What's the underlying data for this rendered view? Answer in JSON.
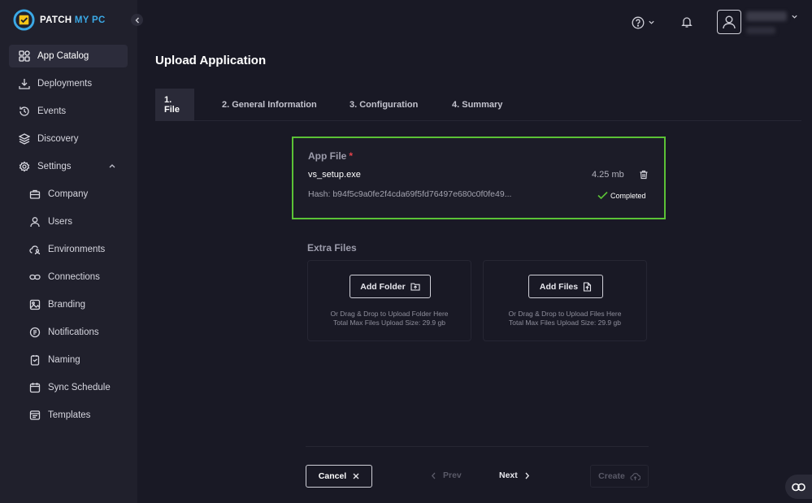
{
  "brand": {
    "name_part1": "PATCH ",
    "name_part2": "MY PC",
    "accent": "#3ba9e6"
  },
  "sidebar": {
    "items": [
      {
        "label": "App Catalog",
        "icon": "grid-icon"
      },
      {
        "label": "Deployments",
        "icon": "download-icon"
      },
      {
        "label": "Events",
        "icon": "history-icon"
      },
      {
        "label": "Discovery",
        "icon": "layers-icon"
      },
      {
        "label": "Settings",
        "icon": "gear-icon"
      },
      {
        "label": "Company",
        "icon": "briefcase-icon"
      },
      {
        "label": "Users",
        "icon": "user-icon"
      },
      {
        "label": "Environments",
        "icon": "cloud-user-icon"
      },
      {
        "label": "Connections",
        "icon": "link-icon"
      },
      {
        "label": "Branding",
        "icon": "image-icon"
      },
      {
        "label": "Notifications",
        "icon": "bell-list-icon"
      },
      {
        "label": "Naming",
        "icon": "naming-icon"
      },
      {
        "label": "Sync Schedule",
        "icon": "calendar-icon"
      },
      {
        "label": "Templates",
        "icon": "template-icon"
      }
    ]
  },
  "page": {
    "title": "Upload Application"
  },
  "tabs": [
    {
      "label": "1. File"
    },
    {
      "label": "2. General Information"
    },
    {
      "label": "3. Configuration"
    },
    {
      "label": "4. Summary"
    }
  ],
  "app_file": {
    "label": "App File",
    "required_mark": "*",
    "file_name": "vs_setup.exe",
    "file_size": "4.25 mb",
    "hash": "Hash: b94f5c9a0fe2f4cda69f5fd76497e680c0f0fe49...",
    "status": "Completed",
    "border_color": "#5bc236"
  },
  "extra_files": {
    "label": "Extra Files",
    "folder": {
      "button": "Add Folder",
      "hint1": "Or Drag & Drop to Upload Folder Here",
      "hint2": "Total Max Files Upload Size: 29.9 gb"
    },
    "files": {
      "button": "Add Files",
      "hint1": "Or Drag & Drop to Upload Files Here",
      "hint2": "Total Max Files Upload Size: 29.9 gb"
    }
  },
  "footer": {
    "cancel": "Cancel",
    "prev": "Prev",
    "next": "Next",
    "create": "Create"
  }
}
